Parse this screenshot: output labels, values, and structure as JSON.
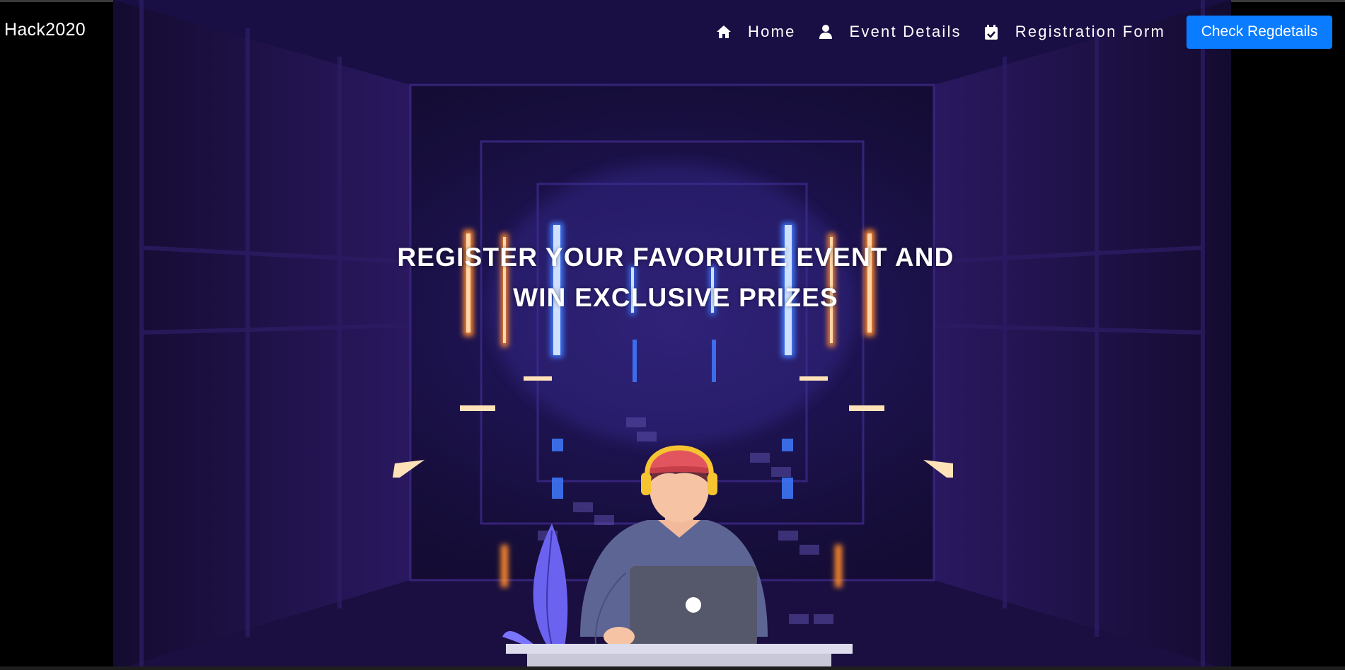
{
  "brand": {
    "name": "Hack2020"
  },
  "nav": {
    "items": [
      {
        "label": "Home",
        "icon": "home-icon"
      },
      {
        "label": "Event Details",
        "icon": "user-icon"
      },
      {
        "label": "Registration Form",
        "icon": "calendar-check-icon"
      }
    ],
    "cta_label": "Check Regdetails"
  },
  "hero": {
    "headline_line1": "REGISTER YOUR FAVORUITE EVENT AND",
    "headline_line2": "WIN EXCLUSIVE PRIZES"
  },
  "colors": {
    "accent": "#0a7cff",
    "background": "#000000",
    "hero_purple": "#1d1350",
    "neon_blue": "#3f7bff",
    "neon_orange": "#ff8a2a"
  }
}
